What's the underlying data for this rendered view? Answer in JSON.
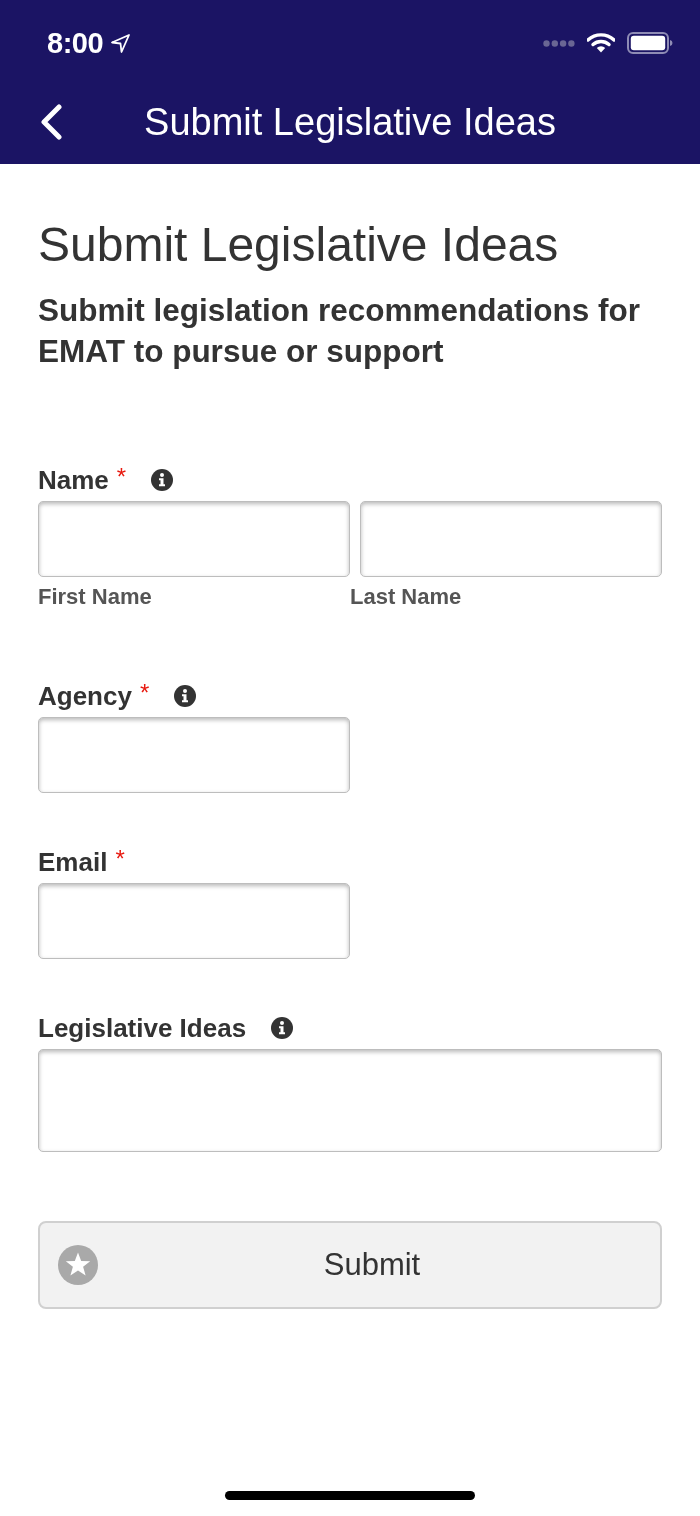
{
  "status_bar": {
    "time": "8:00"
  },
  "nav_bar": {
    "title": "Submit Legislative Ideas"
  },
  "page": {
    "heading": "Submit Legislative Ideas",
    "subheading": "Submit legislation recommendations for EMAT to pursue or support"
  },
  "form": {
    "fields": [
      {
        "kind": "split",
        "label": "Name",
        "required_mark": "*",
        "info": true,
        "inputs": [
          {
            "sublabel": "First Name"
          },
          {
            "sublabel": "Last Name"
          }
        ]
      },
      {
        "kind": "text",
        "label": "Agency",
        "required_mark": "*",
        "info": true
      },
      {
        "kind": "text",
        "label": "Email",
        "required_mark": "*",
        "info": false
      },
      {
        "kind": "textarea",
        "label": "Legislative Ideas",
        "info": true
      }
    ]
  },
  "submit_button": {
    "label": "Submit"
  }
}
